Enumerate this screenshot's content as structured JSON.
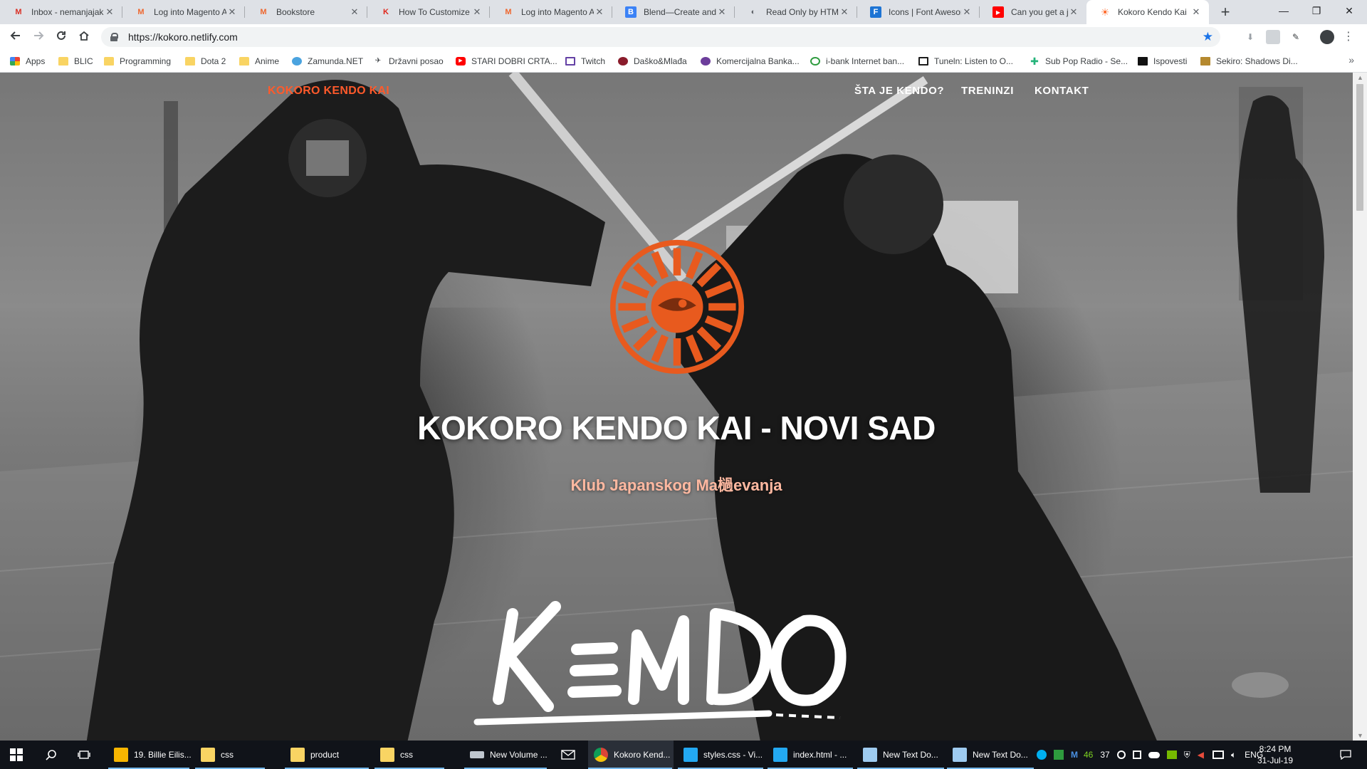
{
  "browser": {
    "tabs": [
      {
        "title": "Inbox - nemanjajak",
        "icon": "gmail-icon",
        "icon_char": "M",
        "icon_color": "#d93025"
      },
      {
        "title": "Log into Magento A",
        "icon": "magento-icon",
        "icon_char": "M",
        "icon_color": "#ee672f"
      },
      {
        "title": "Bookstore",
        "icon": "magento-icon",
        "icon_char": "M",
        "icon_color": "#ee672f"
      },
      {
        "title": "How To Customize I",
        "icon": "bitbucket-icon",
        "icon_char": "K",
        "icon_color": "#e0261b"
      },
      {
        "title": "Log into Magento A",
        "icon": "magento-icon",
        "icon_char": "M",
        "icon_color": "#ee672f"
      },
      {
        "title": "Blend—Create and",
        "icon": "blend-icon",
        "icon_char": "B",
        "icon_color": "#3b82f6"
      },
      {
        "title": "Read Only by HTML",
        "icon": "globe-icon",
        "icon_char": "◐",
        "icon_color": "#5f6368"
      },
      {
        "title": "Icons | Font Awesom",
        "icon": "fontawesome-icon",
        "icon_char": "F",
        "icon_color": "#1d74d4"
      },
      {
        "title": "Can you get a job w",
        "icon": "youtube-icon",
        "icon_char": "▶",
        "icon_color": "#ff0000"
      },
      {
        "title": "Kokoro Kendo Kai",
        "icon": "kokoro-icon",
        "icon_char": "☀",
        "icon_color": "#ff6a2b"
      }
    ],
    "new_tab": "+",
    "window_controls": {
      "minimize": "—",
      "restore": "❐",
      "close": "✕"
    },
    "url": "https://kokoro.netlify.com",
    "bookmarks": [
      {
        "label": "Apps",
        "icon": "apps-grid-icon"
      },
      {
        "label": "BLIC",
        "icon": "folder-icon"
      },
      {
        "label": "Programming",
        "icon": "folder-icon"
      },
      {
        "label": "Dota 2",
        "icon": "folder-icon"
      },
      {
        "label": "Anime",
        "icon": "folder-icon"
      },
      {
        "label": "Zamunda.NET",
        "icon": "zamunda-icon"
      },
      {
        "label": "Državni posao",
        "icon": "bird-icon"
      },
      {
        "label": "STARI DOBRI CRTA...",
        "icon": "youtube-icon"
      },
      {
        "label": "Twitch",
        "icon": "twitch-icon"
      },
      {
        "label": "Daško&Mlađa",
        "icon": "podcast-icon"
      },
      {
        "label": "Komercijalna Banka...",
        "icon": "bank-icon"
      },
      {
        "label": "i-bank Internet ban...",
        "icon": "ibank-icon"
      },
      {
        "label": "Tuneln: Listen to O...",
        "icon": "tunein-icon"
      },
      {
        "label": "Sub Pop Radio - Se...",
        "icon": "subpop-icon"
      },
      {
        "label": "Ispovesti",
        "icon": "ispovesti-icon"
      },
      {
        "label": "Sekiro: Shadows Di...",
        "icon": "sekiro-icon"
      }
    ],
    "bookmarks_more": "»"
  },
  "site": {
    "brand": "KOKORO KENDO KAI",
    "menu": [
      "ŠTA JE KENDO?",
      "TRENINZI",
      "KONTAKT"
    ],
    "hero_title": "KOKORO KENDO KAI - NOVI SAD",
    "hero_subtitle": "Klub Japanskog Ma檛evanja",
    "kendo_calligraphy": "KENDO",
    "accent_color": "#ff5a2b",
    "logo_color": "#e85a1e"
  },
  "taskbar": {
    "apps": [
      {
        "label": "19. Billie Eilis...",
        "icon": "winamp-icon",
        "color": "#f7b500"
      },
      {
        "label": "css",
        "icon": "folder-icon",
        "color": "#f9d463"
      },
      {
        "label": "product",
        "icon": "folder-icon",
        "color": "#f9d463"
      },
      {
        "label": "css",
        "icon": "folder-icon",
        "color": "#f9d463"
      },
      {
        "label": "New Volume ...",
        "icon": "drive-icon",
        "color": "#bfc6cf"
      },
      {
        "label": "Kokoro Kend...",
        "icon": "chrome-icon",
        "color": "#db4437"
      },
      {
        "label": "styles.css - Vi...",
        "icon": "vscode-icon",
        "color": "#23a9f2"
      },
      {
        "label": "index.html - ...",
        "icon": "vscode-icon",
        "color": "#23a9f2"
      },
      {
        "label": "New Text Do...",
        "icon": "notepad-icon",
        "color": "#9ecbf0"
      },
      {
        "label": "New Text Do...",
        "icon": "notepad-icon",
        "color": "#9ecbf0"
      }
    ],
    "tray_numbers": [
      "46",
      "37"
    ],
    "language": "ENG",
    "time": "8:24 PM",
    "date": "31-Jul-19"
  }
}
